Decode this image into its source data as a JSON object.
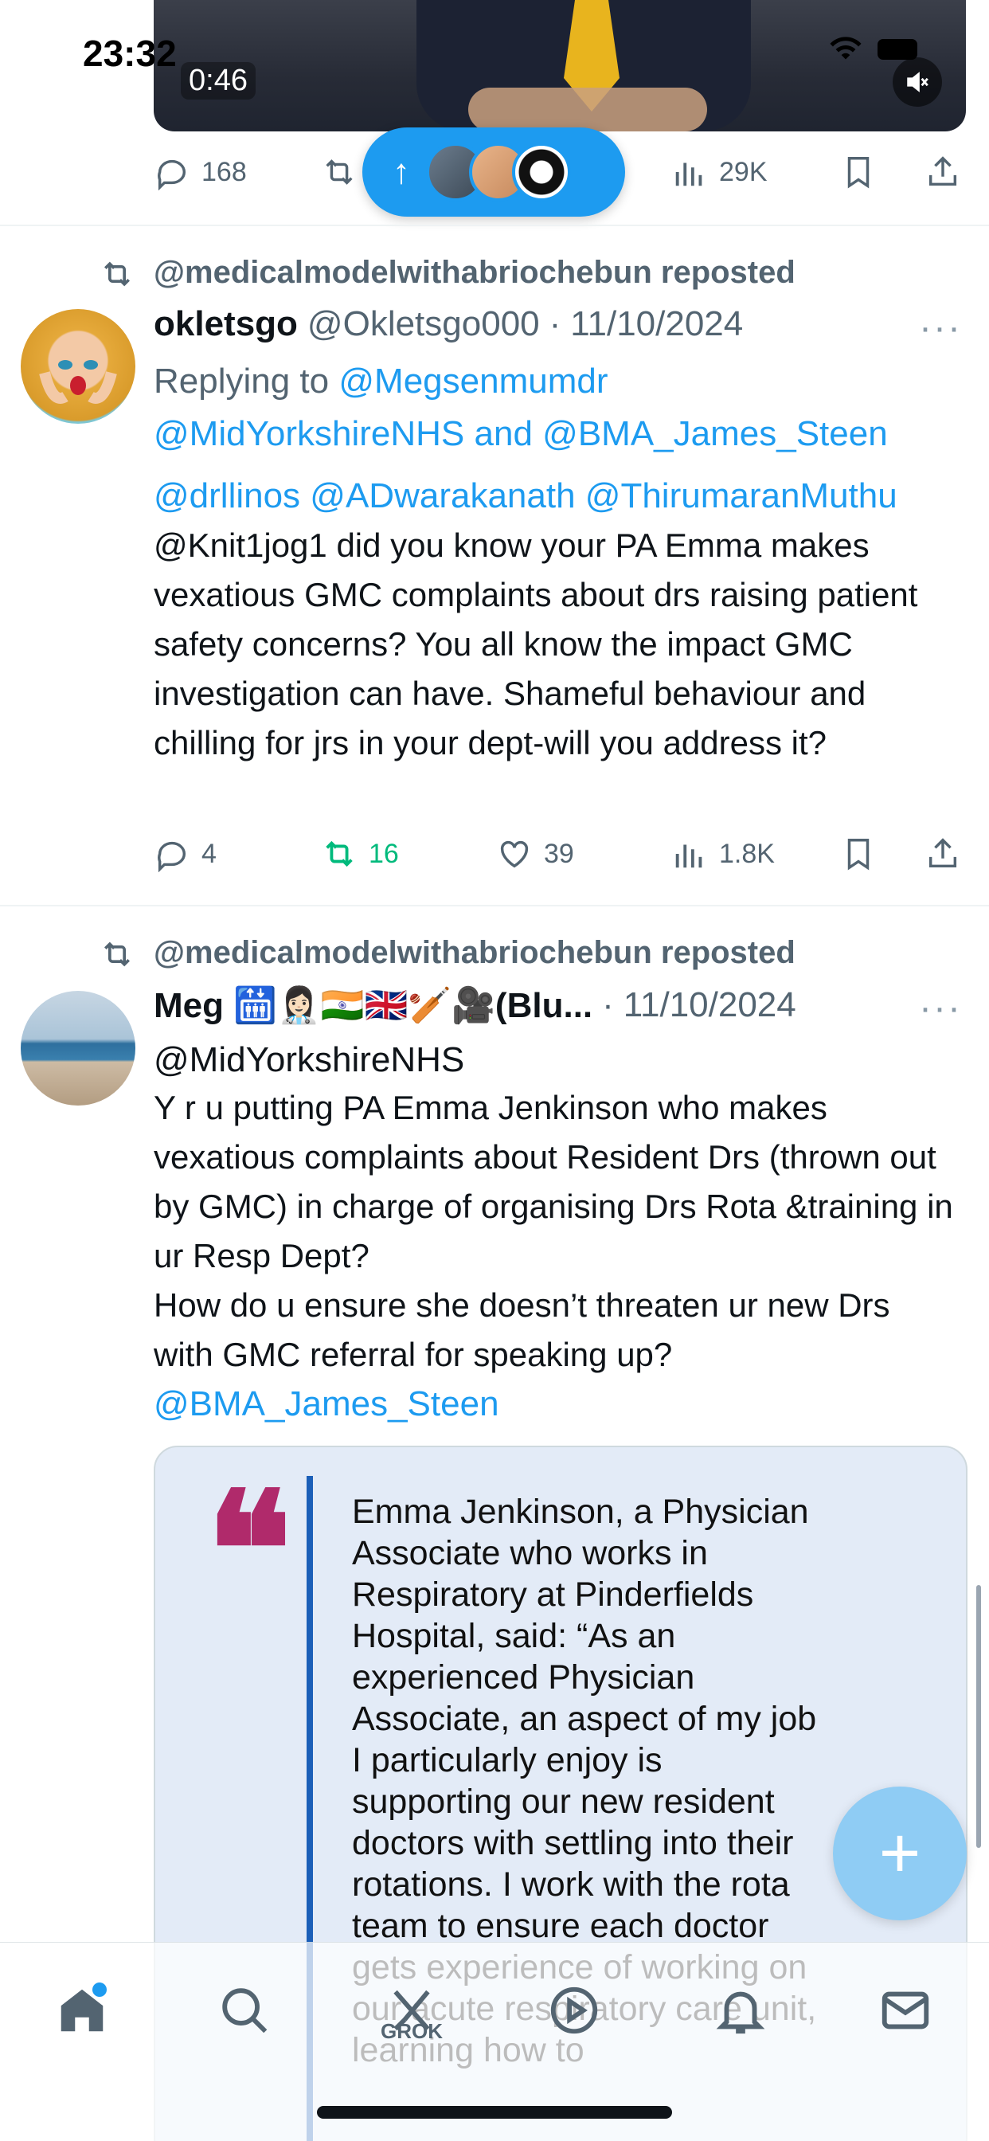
{
  "status_bar": {
    "time": "23:32"
  },
  "video": {
    "timestamp": "0:46"
  },
  "top_tweet_actions": {
    "replies": "168",
    "views": "29K"
  },
  "new_posts_pill": {
    "arrow": "↑"
  },
  "tweets": [
    {
      "repost_by": "@medicalmodelwithabriochebun reposted",
      "name": "okletsgo",
      "handle": "@Okletsgo000",
      "date": "11/10/2024",
      "more": "···",
      "replying_prefix": "Replying to",
      "replying_1": "@Megsenmumdr",
      "replying_2": "@MidYorkshireNHS",
      "replying_and": "and",
      "replying_3": "@BMA_James_Steen",
      "mention_1": "@drllinos",
      "mention_2": "@ADwarakanath",
      "mention_3": "@ThirumaranMuthu",
      "text": "@Knit1jog1 did you know your PA Emma makes vexatious GMC complaints about drs raising patient safety concerns? You all know the impact GMC investigation can have. Shameful behaviour and chilling for jrs in your dept-will you address it?",
      "replies": "4",
      "reposts": "16",
      "likes": "39",
      "views": "1.8K"
    },
    {
      "repost_by": "@medicalmodelwithabriochebun reposted",
      "name": "Meg 🛗👩🏻‍⚕️🇮🇳🇬🇧🏏🎥(Blu...",
      "date": "11/10/2024",
      "more": "···",
      "mention_top": "@MidYorkshireNHS",
      "text": "Y r u putting PA Emma Jenkinson who makes vexatious complaints about Resident Drs (thrown out by GMC) in charge of organising Drs Rota &training in ur Resp Dept?\nHow do u ensure she doesn’t threaten ur new Drs with GMC referral for speaking up?",
      "mention_bottom": "@BMA_James_Steen",
      "quote_mark": "❝",
      "quote": "Emma Jenkinson, a Physician Associate who works in Respiratory at Pinderfields Hospital, said: “As an experienced Physician Associate, an aspect of my job I particularly enjoy is supporting our new resident doctors with settling into their rotations. I work with the rota team to ensure each doctor gets experience of working on our acute respiratory care unit, learning how to"
    }
  ],
  "fab": {
    "label": "+"
  },
  "tabbar": {
    "grok_label": "GROK"
  },
  "colors": {
    "accent": "#1d9bf0",
    "repost_green": "#00ba7c",
    "quote_mark": "#b02a6b"
  }
}
